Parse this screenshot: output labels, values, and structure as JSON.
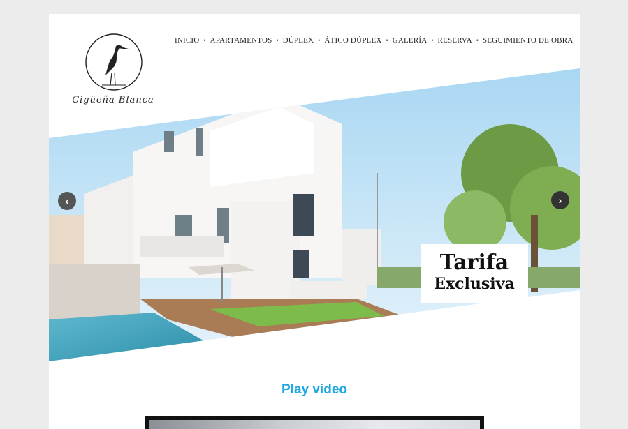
{
  "logo": {
    "text": "Cigüeña Blanca",
    "icon": "stork-icon"
  },
  "nav": {
    "items": [
      {
        "label": "INICIO"
      },
      {
        "label": "APARTAMENTOS"
      },
      {
        "label": "DÚPLEX"
      },
      {
        "label": "ÁTICO DÚPLEX"
      },
      {
        "label": "GALERÍA"
      },
      {
        "label": "RESERVA"
      },
      {
        "label": "SEGUIMIENTO DE OBRA"
      }
    ],
    "separator": "•"
  },
  "hero": {
    "tag_line1": "Tarifa",
    "tag_line2": "Exclusiva",
    "prev_icon": "chevron-left-icon",
    "next_icon": "chevron-right-icon",
    "prev_glyph": "‹",
    "next_glyph": "›"
  },
  "video": {
    "title": "Play video"
  },
  "colors": {
    "background": "#ececec",
    "accent": "#1ea7e1",
    "nav_text": "#222222"
  }
}
